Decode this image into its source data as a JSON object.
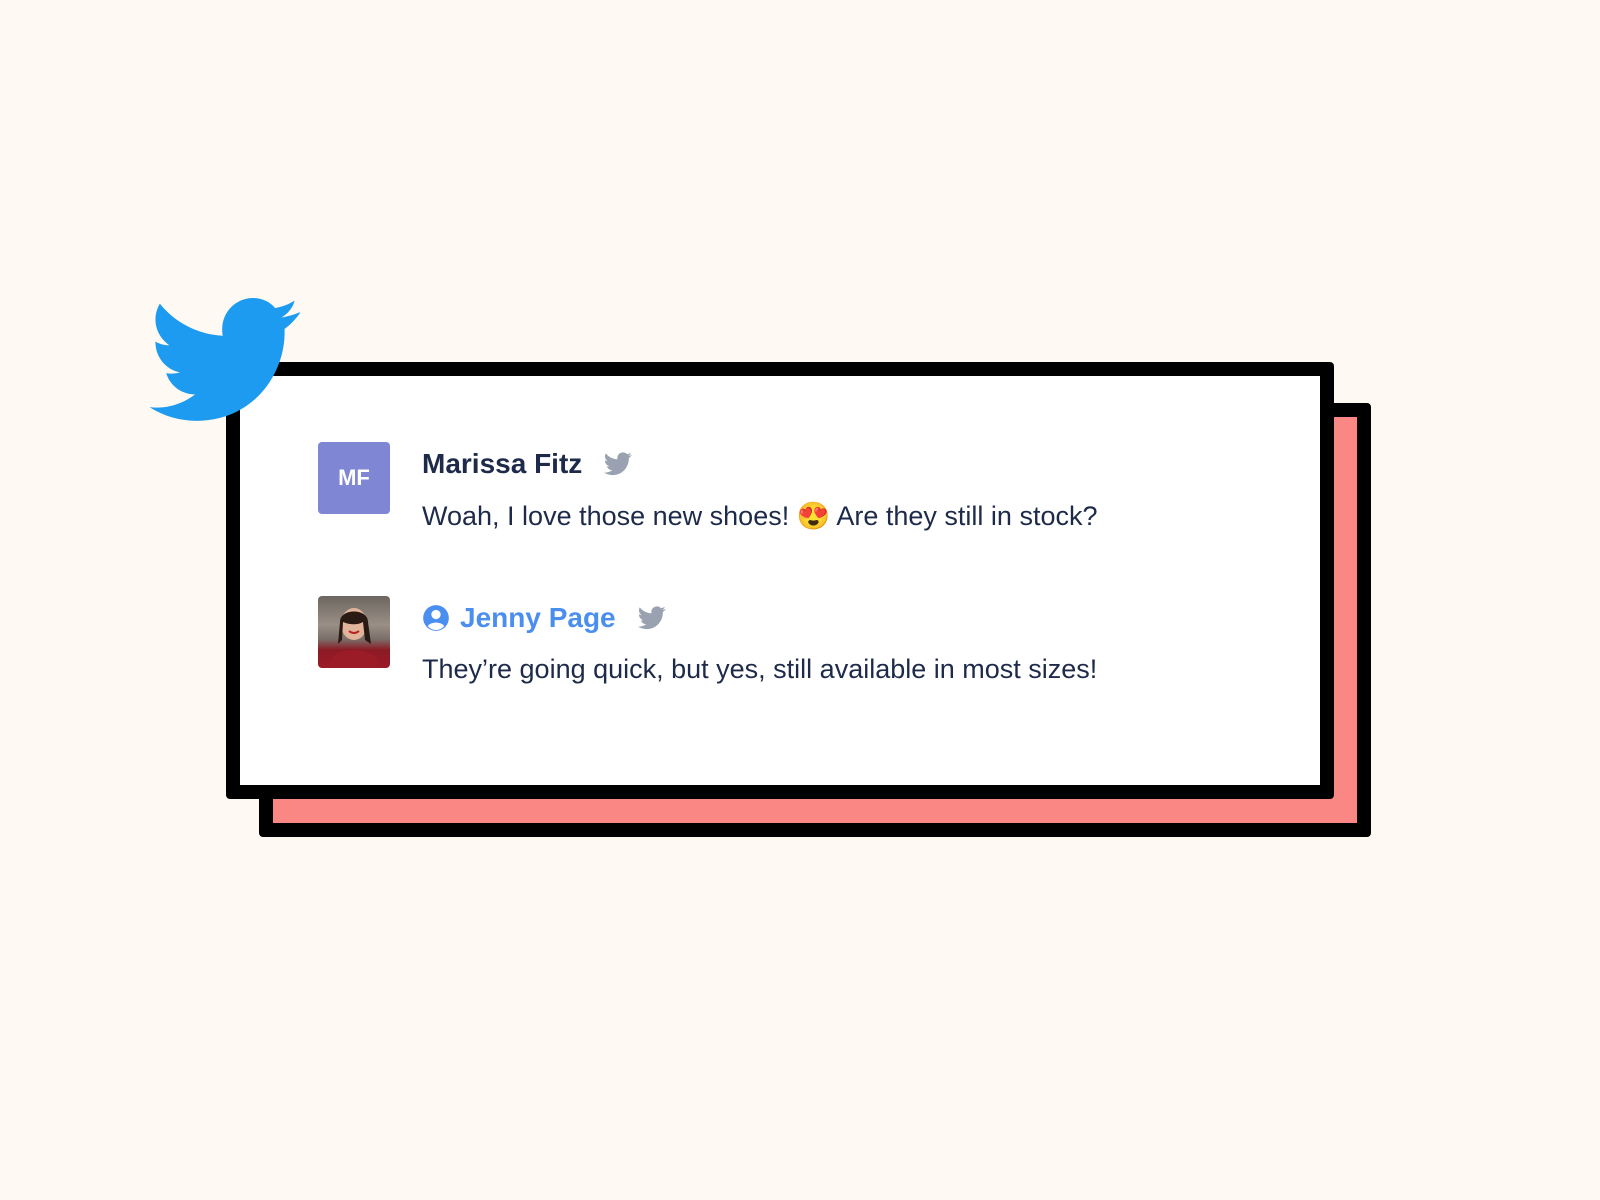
{
  "brand_icon": "twitter-bird-icon",
  "colors": {
    "twitter_blue": "#1d9bf0",
    "shadow": "#fa8783",
    "avatar_mf": "#7f86d3",
    "name_dark": "#1e2a4a",
    "name_blue": "#4a8ef0"
  },
  "comments": [
    {
      "initials": "MF",
      "name": "Marissa Fitz",
      "source_icon": "twitter-icon",
      "text_before": "Woah, I love those new shoes!",
      "emoji": "😍",
      "text_after": "Are they still in stock?"
    },
    {
      "name": "Jenny Page",
      "badge_icon": "user-circle-icon",
      "source_icon": "twitter-icon",
      "text": "They’re going quick, but yes, still available in most sizes!"
    }
  ]
}
